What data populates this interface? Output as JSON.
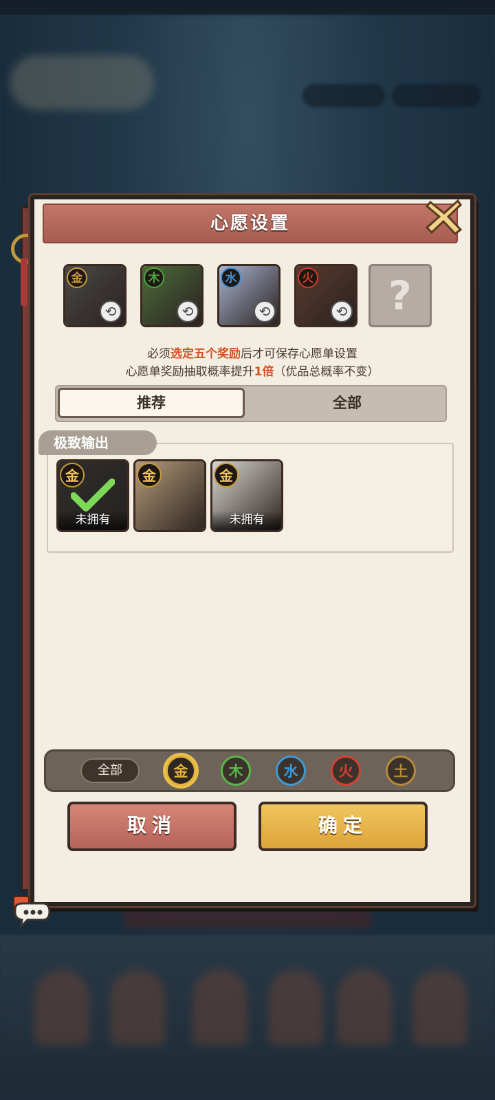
{
  "dialog": {
    "title": "心愿设置",
    "notice_prefix": "必须",
    "notice_highlight": "选定五个奖励",
    "notice_suffix": "后才可保存心愿单设置",
    "rate_prefix": "心愿单奖励抽取概率提升",
    "rate_highlight": "1倍",
    "rate_suffix": "（优品总概率不变）"
  },
  "selected_slots": [
    {
      "element": "金",
      "color": "#c99a3d",
      "portrait": "#4a4846"
    },
    {
      "element": "木",
      "color": "#4aa540",
      "portrait": "#4d6b3a"
    },
    {
      "element": "水",
      "color": "#3e8fd0",
      "portrait": "#a7b2cf"
    },
    {
      "element": "火",
      "color": "#d13b2e",
      "portrait": "#5a3a2c"
    }
  ],
  "empty_slot_symbol": "?",
  "tabs": {
    "recommended": "推荐",
    "all": "全部"
  },
  "section": {
    "title": "极致输出",
    "cards": [
      {
        "element": "金",
        "status": "未拥有",
        "selected": true,
        "portrait": "#3a3a38"
      },
      {
        "element": "金",
        "status": "",
        "selected": false,
        "portrait": "#b59a7a"
      },
      {
        "element": "金",
        "status": "未拥有",
        "selected": false,
        "portrait": "#d8d5d2"
      }
    ]
  },
  "filter": {
    "all": "全部",
    "elements": [
      {
        "label": "金",
        "color": "#e2b13c"
      },
      {
        "label": "木",
        "color": "#58b74a"
      },
      {
        "label": "水",
        "color": "#3d9ad8"
      },
      {
        "label": "火",
        "color": "#d8402f"
      },
      {
        "label": "土",
        "color": "#b7893a"
      }
    ]
  },
  "buttons": {
    "cancel": "取消",
    "confirm": "确定"
  },
  "icons": [
    "close-icon",
    "swap-icon",
    "checkmark-icon",
    "question-mark-icon",
    "chat-bubble-icon"
  ]
}
